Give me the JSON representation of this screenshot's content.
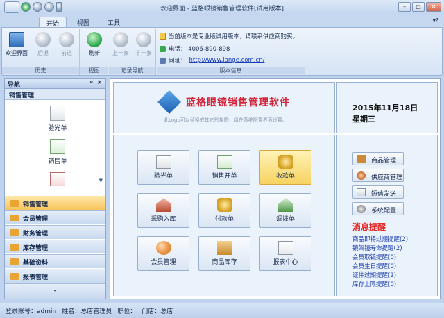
{
  "window": {
    "title": "欢迎界面 - 蓝格眼镜销售管理软件[试用版本]"
  },
  "tabs": [
    "开始",
    "视图",
    "工具"
  ],
  "ribbon": {
    "history": {
      "label": "历史",
      "welcome": "欢迎界面",
      "back": "后退",
      "forward": "前进"
    },
    "view": {
      "label": "视图",
      "refresh": "刷新"
    },
    "record": {
      "label": "记录导航",
      "prev": "上一条",
      "next": "下一条"
    },
    "version": {
      "label": "版本信息",
      "notice": "当前版本是专业版试用版本，请联系供应商购买。",
      "phone": "电话：  4006-890-898",
      "site_label": "网址：",
      "site_url": "http://www.lange.com.cn/"
    }
  },
  "nav": {
    "header": "导航",
    "pin": "ᵖ",
    "close": "×",
    "section": "销售管理",
    "items": [
      "验光单",
      "销售单"
    ],
    "modules": [
      "销售管理",
      "会员管理",
      "财务管理",
      "库存管理",
      "基础资料",
      "报表管理"
    ]
  },
  "main": {
    "brand": "蓝格眼镜销售管理软件",
    "brand_sub": "此Logo可以替换成其它形象图，请在系统配置界面设置。",
    "date": "2015年11月18日",
    "weekday": "星期三",
    "tiles": [
      "验光单",
      "销售开单",
      "收款单",
      "采购入库",
      "付款单",
      "调拨单",
      "会员管理",
      "商品库存",
      "报表中心"
    ],
    "side_buttons": [
      "商品管理",
      "供应商管理",
      "短信发送",
      "系统配置"
    ],
    "msg_title": "消息提醒",
    "messages": [
      "商品即将过期提醒(2)",
      "镜架镜寿命提醒(2)",
      "会员取镜提醒(0)",
      "会员生日提醒(0)",
      "证件过期提醒(2)",
      "库存上限提醒(0)"
    ]
  },
  "status": {
    "account": "登录账号：admin",
    "name": "姓名：总店管理员",
    "position": "职位：",
    "store": "门店：总店"
  },
  "colors": {
    "accent": "#f8c45a",
    "brand": "#d3253a",
    "message": "#e32c28",
    "link": "#1d3eaf"
  }
}
